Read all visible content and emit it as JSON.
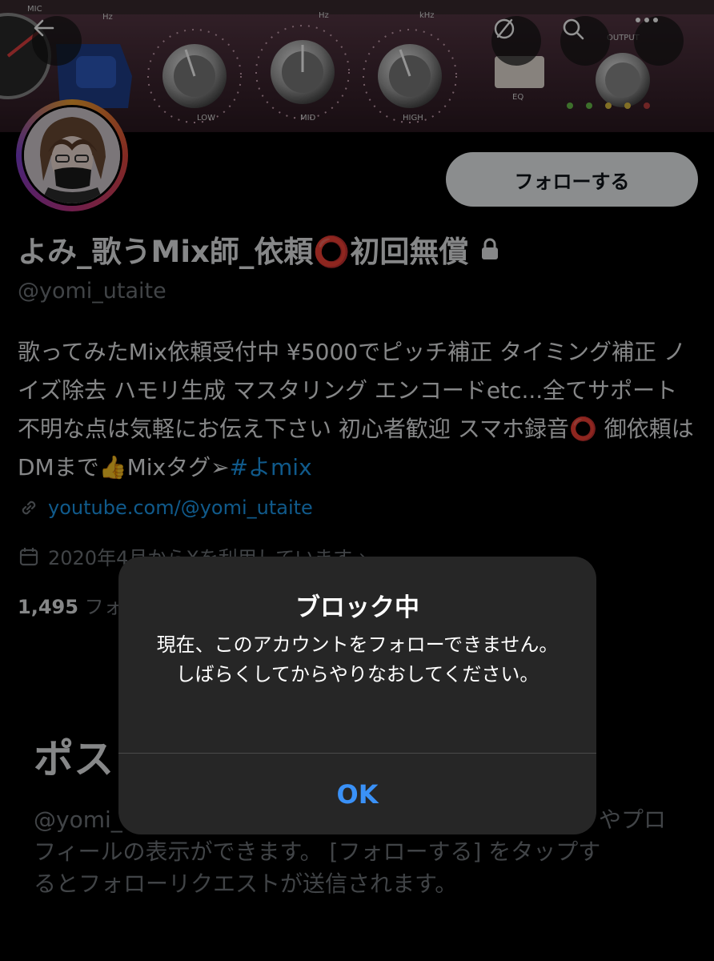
{
  "header": {
    "back_icon": "arrow-left-icon",
    "hide_icon": "circle-slash-icon",
    "search_icon": "search-icon",
    "more_icon": "more-horizontal-icon",
    "banner": {
      "mic_label": "MIC",
      "hz_label": "Hz",
      "khz_label": "kHz",
      "output_label": "OUTPUT",
      "eq_label": "EQ",
      "low_label": "LOW",
      "mid_label": "MID",
      "high_label": "HIGH"
    }
  },
  "profile": {
    "display_name": "よみ_歌うMix師_依頼⭕初回無償",
    "lock_icon": "lock-icon",
    "handle": "@yomi_utaite",
    "follow_button": "フォローする",
    "bio_text": "歌ってみたMix依頼受付中 ¥5000でピッチ補正 タイミング補正 ノイズ除去 ハモリ生成 マスタリング エンコードetc...全てサポート 不明な点は気軽にお伝え下さい 初心者歓迎 スマホ録音⭕ 御依頼はDMまで👍Mixタグ➢",
    "bio_hashtag": "#よmix",
    "link_icon": "link-icon",
    "link_text": "youtube.com/@yomi_utaite",
    "calendar_icon": "calendar-icon",
    "joined_text": "2020年4月からXを利用しています",
    "joined_chevron": "›",
    "follow_count": "1,495",
    "follow_label_partial": "フォ"
  },
  "posts": {
    "title_partial": "ポス",
    "body_line1_start": "@yomi_",
    "body_line1_end": "やプロ",
    "body_line2": "フィールの表示ができます。 [フォローする] をタップす",
    "body_line3": "るとフォローリクエストが送信されます。"
  },
  "alert": {
    "title": "ブロック中",
    "message": "現在、このアカウントをフォローできません。しばらくしてからやりなおしてください。",
    "ok_button": "OK"
  },
  "colors": {
    "accent": "#1d9bf0",
    "alert_ok": "#3a91f7",
    "alert_bg": "#262626"
  }
}
